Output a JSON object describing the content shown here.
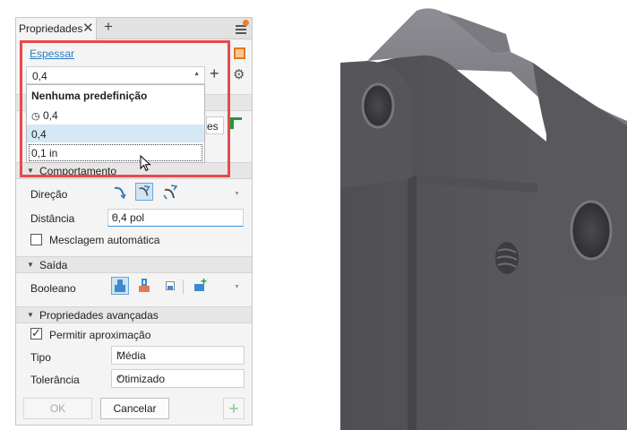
{
  "panel": {
    "tab_label": "Propriedades",
    "link_label": "Espessar",
    "thickness_value": "0,4",
    "dropdown": {
      "header": "Nenhuma predefinição",
      "history_item": "0,4",
      "highlighted_item": "0,4",
      "focused_item": "0,1 in"
    },
    "hidden_fragment": "es",
    "sections": {
      "comportamento": "Comportamento",
      "saida": "Saída",
      "avancadas": "Propriedades avançadas"
    },
    "direction_label": "Direção",
    "distance_label": "Distância",
    "distance_value": "0,4 pol",
    "auto_blend_label": "Mesclagem automática",
    "boolean_label": "Booleano",
    "allow_approx_label": "Permitir aproximação",
    "type_label": "Tipo",
    "type_value": "Média",
    "tolerance_label": "Tolerância",
    "tolerance_value": "Otimizado",
    "ok_label": "OK",
    "cancel_label": "Cancelar"
  },
  "colors": {
    "accent_link": "#2b7cc4",
    "highlight_border": "#e9494a",
    "selected_row": "#d5e8f5",
    "model_body": "#5e5e62",
    "notify_dot": "#f08020"
  },
  "icons": [
    "close-icon",
    "add-tab-icon",
    "menu-icon",
    "face-select-icon",
    "add-icon",
    "gear-icon",
    "history-clock-icon",
    "direction-icons",
    "boolean-icons",
    "mouse-cursor-icon",
    "apply-plus-icon"
  ]
}
